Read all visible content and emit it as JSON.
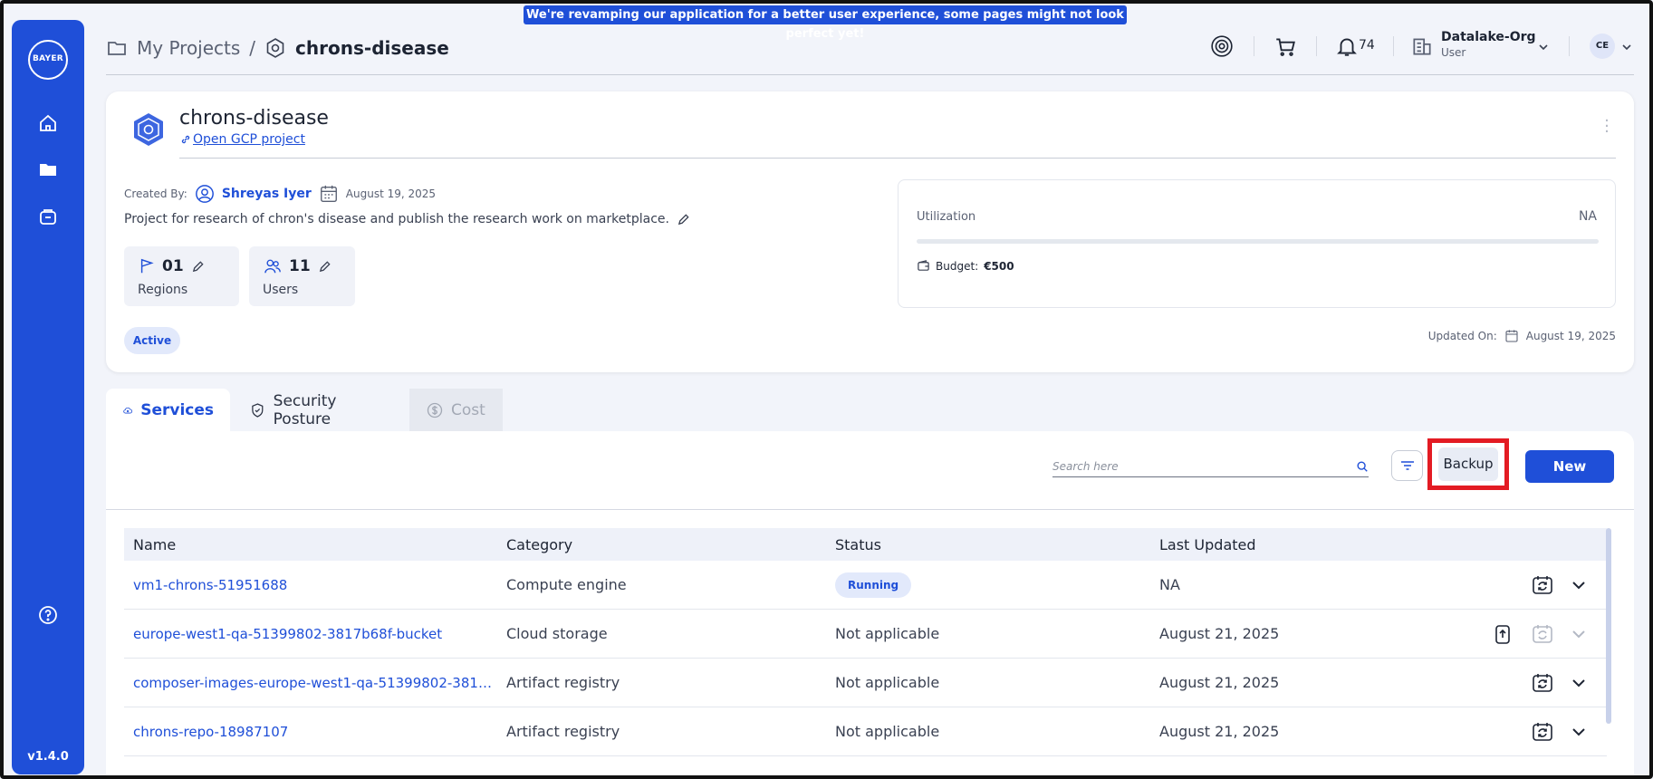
{
  "banner": {
    "text": "We're revamping our application for a better user experience, some pages might not look perfect yet!"
  },
  "sidebar": {
    "logo": {
      "horizontal": "BAYER",
      "vertical": "BAYER"
    },
    "items": [
      {
        "icon": "home-icon"
      },
      {
        "icon": "folder-icon"
      },
      {
        "icon": "bag-icon"
      }
    ],
    "help_icon": "help-icon",
    "version": "v1.4.0"
  },
  "header": {
    "breadcrumb_root": "My Projects",
    "breadcrumb_sep": "/",
    "breadcrumb_current": "chrons-disease",
    "notifications_count": "74",
    "org_name": "Datalake-Org",
    "org_role": "User",
    "avatar_initials": "CE"
  },
  "project": {
    "title": "chrons-disease",
    "gcp_link": "Open GCP project",
    "created_by_label": "Created By:",
    "created_by_user": "Shreyas Iyer",
    "created_date": "August 19, 2025",
    "description": "Project for research of chron's disease and publish the research work on marketplace.",
    "regions_count": "01",
    "regions_label": "Regions",
    "users_count": "11",
    "users_label": "Users",
    "status": "Active",
    "utilization_label": "Utilization",
    "utilization_value": "NA",
    "utilization_fraction": 0,
    "budget_label": "Budget:",
    "budget_value": "€500",
    "updated_label": "Updated On:",
    "updated_date": "August 19, 2025"
  },
  "tabs": [
    {
      "label": "Services",
      "state": "active"
    },
    {
      "label": "Security Posture",
      "state": "normal"
    },
    {
      "label": "Cost",
      "state": "disabled"
    }
  ],
  "services": {
    "search_placeholder": "Search here",
    "backup_label": "Backup",
    "new_label": "New",
    "columns": {
      "name": "Name",
      "category": "Category",
      "status": "Status",
      "last_updated": "Last Updated"
    },
    "rows": [
      {
        "name": "vm1-chrons-51951688",
        "category": "Compute engine",
        "status": "Running",
        "last_updated": "NA"
      },
      {
        "name": "europe-west1-qa-51399802-3817b68f-bucket",
        "category": "Cloud storage",
        "status": "Not applicable",
        "last_updated": "August 21, 2025"
      },
      {
        "name": "composer-images-europe-west1-qa-51399802-3817b68f...",
        "category": "Artifact registry",
        "status": "Not applicable",
        "last_updated": "August 21, 2025"
      },
      {
        "name": "chrons-repo-18987107",
        "category": "Artifact registry",
        "status": "Not applicable",
        "last_updated": "August 21, 2025"
      }
    ]
  },
  "colors": {
    "accent": "#1f4fd8",
    "highlight": "#e31b23",
    "background": "#f2f4fa"
  }
}
